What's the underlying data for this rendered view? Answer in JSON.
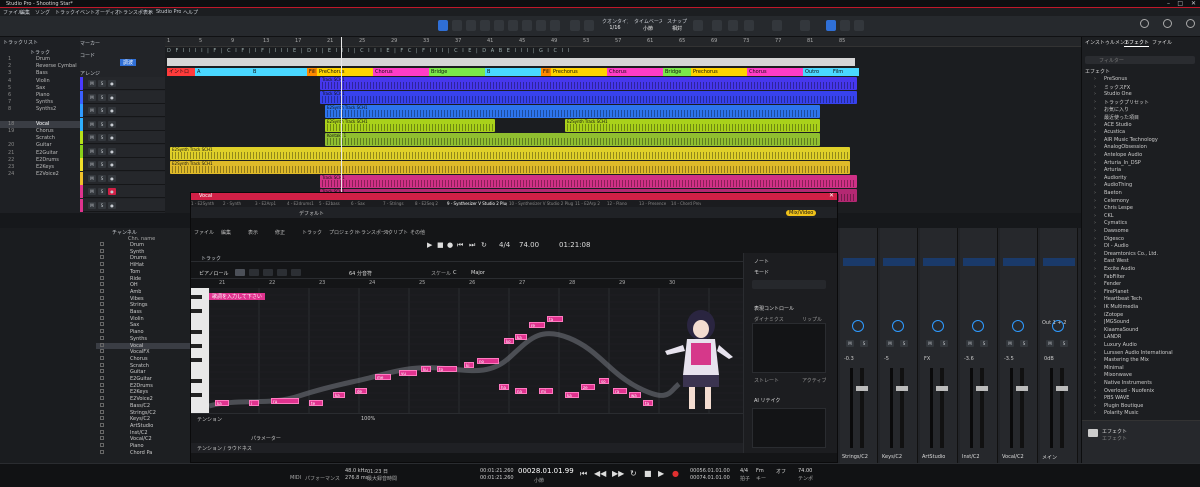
{
  "titlebar": {
    "title": "Studio Pro - Shooting Star*"
  },
  "menu": [
    "ファイル",
    "編集",
    "ソング",
    "トラック",
    "イベント",
    "オーディオ",
    "トランスポート",
    "表示",
    "Studio Pro",
    "ヘルプ"
  ],
  "toolbar": {
    "quantize_label": "クオンタイズ",
    "quantize_value": "1/16",
    "timebase_label": "タイムベース",
    "timebase_value": "小節",
    "snap_label": "スナップ",
    "snap_value": "相対"
  },
  "left_panel": {
    "header": "トラックリスト",
    "search_label": "トラック",
    "marker_label": "マーカー",
    "chord_label": "コード",
    "chord_value": "調波",
    "arrangement_label": "アレンジ",
    "tracks": [
      {
        "num": "1",
        "name": "Drum"
      },
      {
        "num": "2",
        "name": "Reverse Cymbal"
      },
      {
        "num": "3",
        "name": "Bass"
      },
      {
        "num": "4",
        "name": "Violin"
      },
      {
        "num": "5",
        "name": "Sax"
      },
      {
        "num": "6",
        "name": "Piano"
      },
      {
        "num": "7",
        "name": "Synths"
      },
      {
        "num": "8",
        "name": "Synths2"
      },
      {
        "num": "",
        "name": ""
      },
      {
        "num": "18",
        "name": "Vocal"
      },
      {
        "num": "19",
        "name": "Chorus"
      },
      {
        "num": "",
        "name": "Scratch"
      },
      {
        "num": "20",
        "name": "Guitar"
      },
      {
        "num": "21",
        "name": "E2Guitar"
      },
      {
        "num": "22",
        "name": "E2Drums"
      },
      {
        "num": "23",
        "name": "E2Keys"
      },
      {
        "num": "24",
        "name": "E2Voice2"
      }
    ]
  },
  "arranger": {
    "ruler_numbers": [
      "1",
      "5",
      "9",
      "13",
      "17",
      "21",
      "25",
      "29",
      "33",
      "37",
      "41",
      "45",
      "49",
      "53",
      "57",
      "61",
      "65",
      "69",
      "73",
      "77",
      "81",
      "85"
    ],
    "chords_text": "D F I I I I | F | C I F | I F | I I I E | D I | E I I I | C I I I E | F C | F I I I | C I E | D A B E I I I | G I C I I",
    "sections": [
      {
        "label": "イントロ",
        "color": "#ff3b3b"
      },
      {
        "label": "A",
        "color": "#4ad8ff"
      },
      {
        "label": "B",
        "color": "#4ad8ff"
      },
      {
        "label": "Fill",
        "color": "#ff8a00"
      },
      {
        "label": "PreChorus",
        "color": "#ffd400"
      },
      {
        "label": "Chorus",
        "color": "#ff3dc6"
      },
      {
        "label": "Bridge",
        "color": "#7be84a"
      },
      {
        "label": "B",
        "color": "#4ad8ff"
      },
      {
        "label": "Fill",
        "color": "#ff8a00"
      },
      {
        "label": "Prechorus",
        "color": "#ffd400"
      },
      {
        "label": "Chorus",
        "color": "#ff3dc6"
      },
      {
        "label": "Bridge",
        "color": "#7be84a"
      },
      {
        "label": "Prechorus",
        "color": "#ffd400"
      },
      {
        "label": "Chorus",
        "color": "#ff3dc6"
      },
      {
        "label": "Outro",
        "color": "#4ad8ff"
      },
      {
        "label": "Film",
        "color": "#4ad8ff"
      }
    ],
    "clip_labels": {
      "track": "Track SCH1",
      "eq": "E2Synth Track SCH1",
      "short": "Kontakt 1"
    }
  },
  "console_list": {
    "header": "チャンネル",
    "col_header": "Chn. name",
    "channels": [
      "Drum",
      "Synth",
      "Drums",
      "HiHat",
      "Tom",
      "Ride",
      "OH",
      "Amb",
      "Vibes",
      "Strings",
      "Bass",
      "Violin",
      "Sax",
      "Piano",
      "Synths",
      "Vocal",
      "VocalFX",
      "Chorus",
      "Scratch",
      "Guitar",
      "E2Guitar",
      "E2Drums",
      "E2Keys",
      "E2Voice2",
      "Bass/C2",
      "Strings/C2",
      "Keys/C2",
      "ArtStudio",
      "Inst/C2",
      "Vocal/C2",
      "Piano",
      "Chord Pa"
    ]
  },
  "vocal_editor": {
    "title": "Vocal",
    "tabs": [
      "1 - E2Synth",
      "2 - Synth",
      "3 - E2Arp1",
      "4 - E2drums1",
      "5 - E2bass",
      "6 - Sax",
      "7 - Strings",
      "8 - E2Seq 2",
      "9 - Synthesizer V Studio 2 Plugin",
      "10 - Synthesizer V Studio 2 Plugin",
      "11 - E2Arp 2",
      "12 - Piano",
      "13 - Presence",
      "14 - Chord Preview"
    ],
    "preset": "デフォルト",
    "badge": "Mix/Video",
    "menu": [
      "ファイル",
      "編集",
      "表示",
      "修正",
      "トラック",
      "プロジェクト",
      "トランスポート",
      "スクリプト",
      "その他"
    ],
    "time_sig": "4/4",
    "tempo": "74.00",
    "position": "01:21:08",
    "track_label": "トラック",
    "pianoroll_label": "ピアノロール",
    "quant": "64 分音符",
    "scale_label": "スケール",
    "scale_key": "C",
    "scale_mode": "Major",
    "bar_numbers": [
      "21",
      "22",
      "23",
      "24",
      "25",
      "26",
      "27",
      "28",
      "29",
      "30"
    ],
    "group_label": "歌詞を入力して下さい",
    "tension_label": "テンション",
    "zoom": "100%",
    "bottom_label": "テンション / ラウドネス",
    "param_label": "パラメーター",
    "right_panel": {
      "note": "ノート",
      "mode": "モード",
      "expr": "表現コントロール",
      "dynamics": "ダイナミクス",
      "ripple": "リップル",
      "strength": "ストレート",
      "active": "アクティブ",
      "ai_retake": "AI リテイク"
    },
    "notes": [
      "ka",
      "i",
      "ru",
      "te",
      "ka",
      "de",
      "me",
      "yu",
      "ku",
      "to",
      "ki",
      "no",
      "ko",
      "ka",
      "re",
      "ta",
      "ha",
      "na",
      "mi",
      "ka",
      "ze",
      "so",
      "ra",
      "wa",
      "ta"
    ]
  },
  "mixer": {
    "channels": [
      {
        "name": "Strings/C2",
        "value": "-0.3"
      },
      {
        "name": "Keys/C2",
        "value": "-5"
      },
      {
        "name": "ArtStudio",
        "value": "FX"
      },
      {
        "name": "Inst/C2",
        "value": "-3.6"
      },
      {
        "name": "Vocal/C2",
        "value": "-3.5"
      },
      {
        "name": "メイン",
        "value": "0dB"
      }
    ],
    "bus_label": "Out 1 + 2"
  },
  "right_panel": {
    "tabs": [
      "インストゥルメント",
      "エフェクト",
      "ファイル"
    ],
    "search_placeholder": "フィルター",
    "header": "エフェクト",
    "items": [
      "PreSonus",
      "ミックスFX",
      "Studio One",
      "トラックプリセット",
      "お気に入り",
      "最近使った項目",
      "ACE Studio",
      "Acustica",
      "AIR Music Technology",
      "AnalogObsession",
      "Antelope Audio",
      "Arturia_In_DSP",
      "Arturia",
      "Audiority",
      "AudioThing",
      "Baeton",
      "Celemony",
      "Chris Lespe",
      "CKL",
      "Cymatics",
      "Dawsome",
      "Digesco",
      "DI - Audio",
      "Dreamtonics Co., Ltd.",
      "East West",
      "Excite Audio",
      "FabFilter",
      "Fender",
      "FirePlanet",
      "Heartbeat Tech",
      "IK Multimedia",
      "iZotope",
      "JMGSound",
      "KiaamaSound",
      "LANDR",
      "Luxury Audio",
      "Lurssen Audio International",
      "Mastering the Mix",
      "Minimal",
      "Mixonwave",
      "Native Instruments",
      "Overloud - Nuofenix",
      "PBS WAVE",
      "Plugin Boutique",
      "Polarity Music"
    ],
    "footer_title": "エフェクト",
    "footer_sub": "エフェクト"
  },
  "transport": {
    "midi": "MIDI",
    "perf": "パフォーマンス",
    "sample_rate": "48.0 kHz",
    "latency": "276.8 ms",
    "time_a": "01:23 日",
    "record_max": "最大録音時間",
    "time_small": "00:01:21.260",
    "time_small2": "00:01:21.260",
    "bars": "00028.01.01.99",
    "bars_label": "小節",
    "loop_start": "00056.01.01.00",
    "loop_end": "00074.01.01.00",
    "tempo_sig": "4/4",
    "tempo_label": "拍子",
    "key": "Fm",
    "key_label": "キー",
    "met": "オフ",
    "bpm": "74.00",
    "bpm_label": "テンポ"
  },
  "colors": {
    "accent": "#c0182a",
    "vocal": "#e0338f",
    "track_blue": "#4a3aff",
    "track_cyan": "#2f9bff",
    "track_green": "#b6e11a",
    "track_yellow": "#f0e02a"
  }
}
